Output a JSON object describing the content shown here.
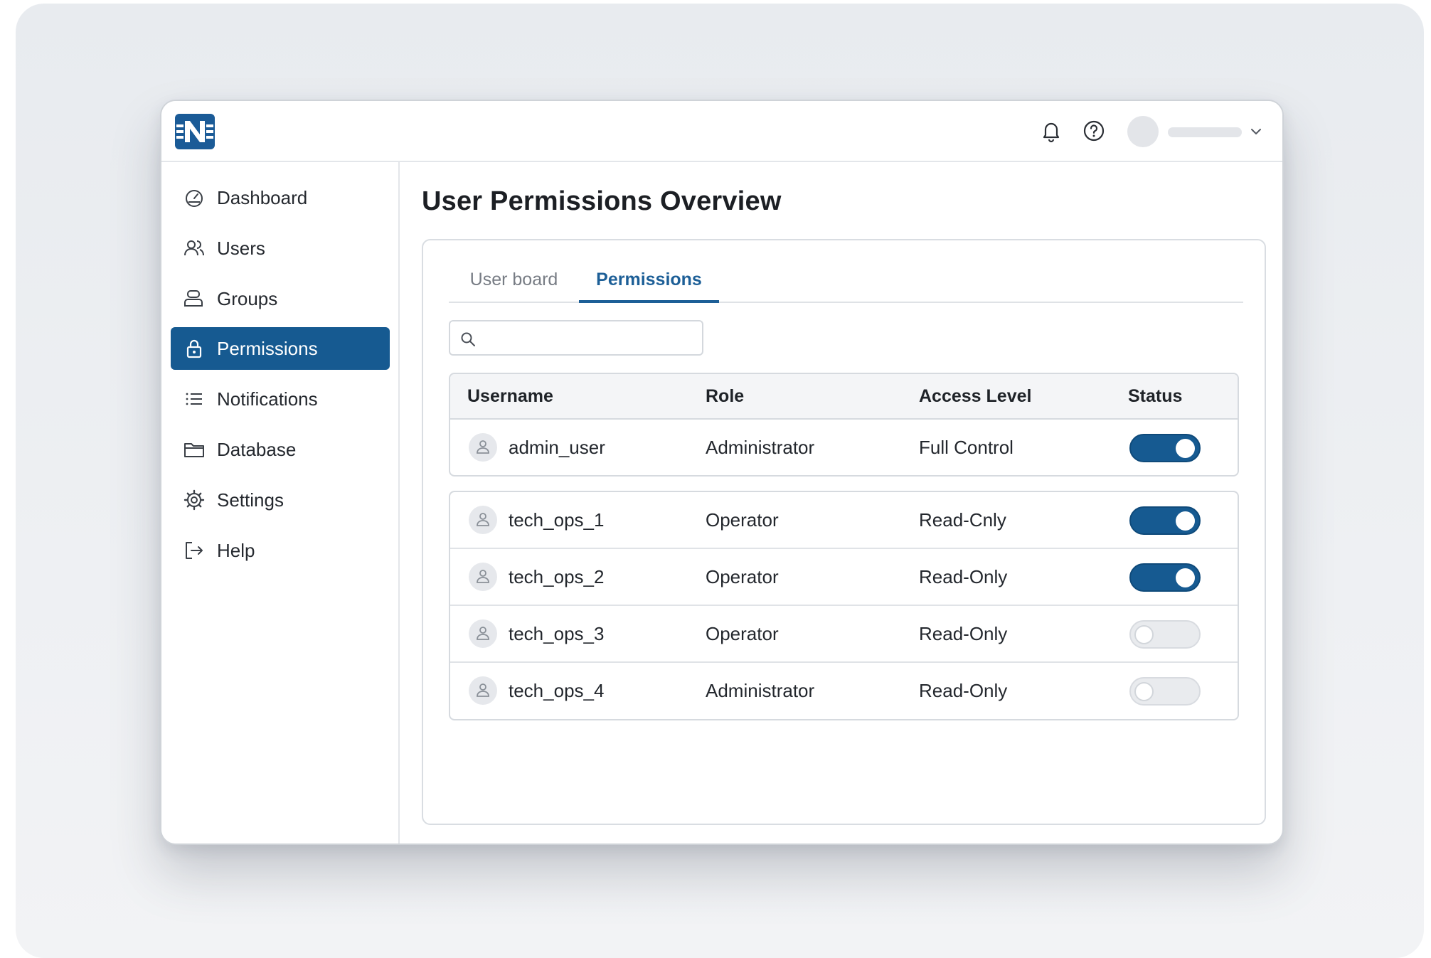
{
  "nav": {
    "items": [
      {
        "label": "Dashboard",
        "icon": "gauge-icon"
      },
      {
        "label": "Users",
        "icon": "users-icon"
      },
      {
        "label": "Groups",
        "icon": "groups-icon"
      },
      {
        "label": "Permissions",
        "icon": "lock-icon",
        "active": true
      },
      {
        "label": "Notifications",
        "icon": "list-icon"
      },
      {
        "label": "Database",
        "icon": "folder-icon"
      },
      {
        "label": "Settings",
        "icon": "gear-icon"
      },
      {
        "label": "Help",
        "icon": "exit-icon"
      }
    ]
  },
  "page": {
    "title": "User Permissions Overview"
  },
  "tabs": [
    {
      "label": "User board",
      "active": false
    },
    {
      "label": "Permissions",
      "active": true
    }
  ],
  "search": {
    "value": "",
    "placeholder": ""
  },
  "table": {
    "headers": [
      "Username",
      "Role",
      "Access Level",
      "Status"
    ],
    "rows": [
      {
        "username": "admin_user",
        "role": "Administrator",
        "access": "Full Control",
        "status_on": true
      },
      {
        "username": "tech_ops_1",
        "role": "Operator",
        "access": "Read-Cnly",
        "status_on": true
      },
      {
        "username": "tech_ops_2",
        "role": "Operator",
        "access": "Read-Only",
        "status_on": true
      },
      {
        "username": "tech_ops_3",
        "role": "Operator",
        "access": "Read-Only",
        "status_on": false
      },
      {
        "username": "tech_ops_4",
        "role": "Administrator",
        "access": "Read-Only",
        "status_on": false
      }
    ]
  },
  "colors": {
    "accent": "#165a91",
    "tab_active": "#1d5f97",
    "backdrop": "#eceef1"
  }
}
